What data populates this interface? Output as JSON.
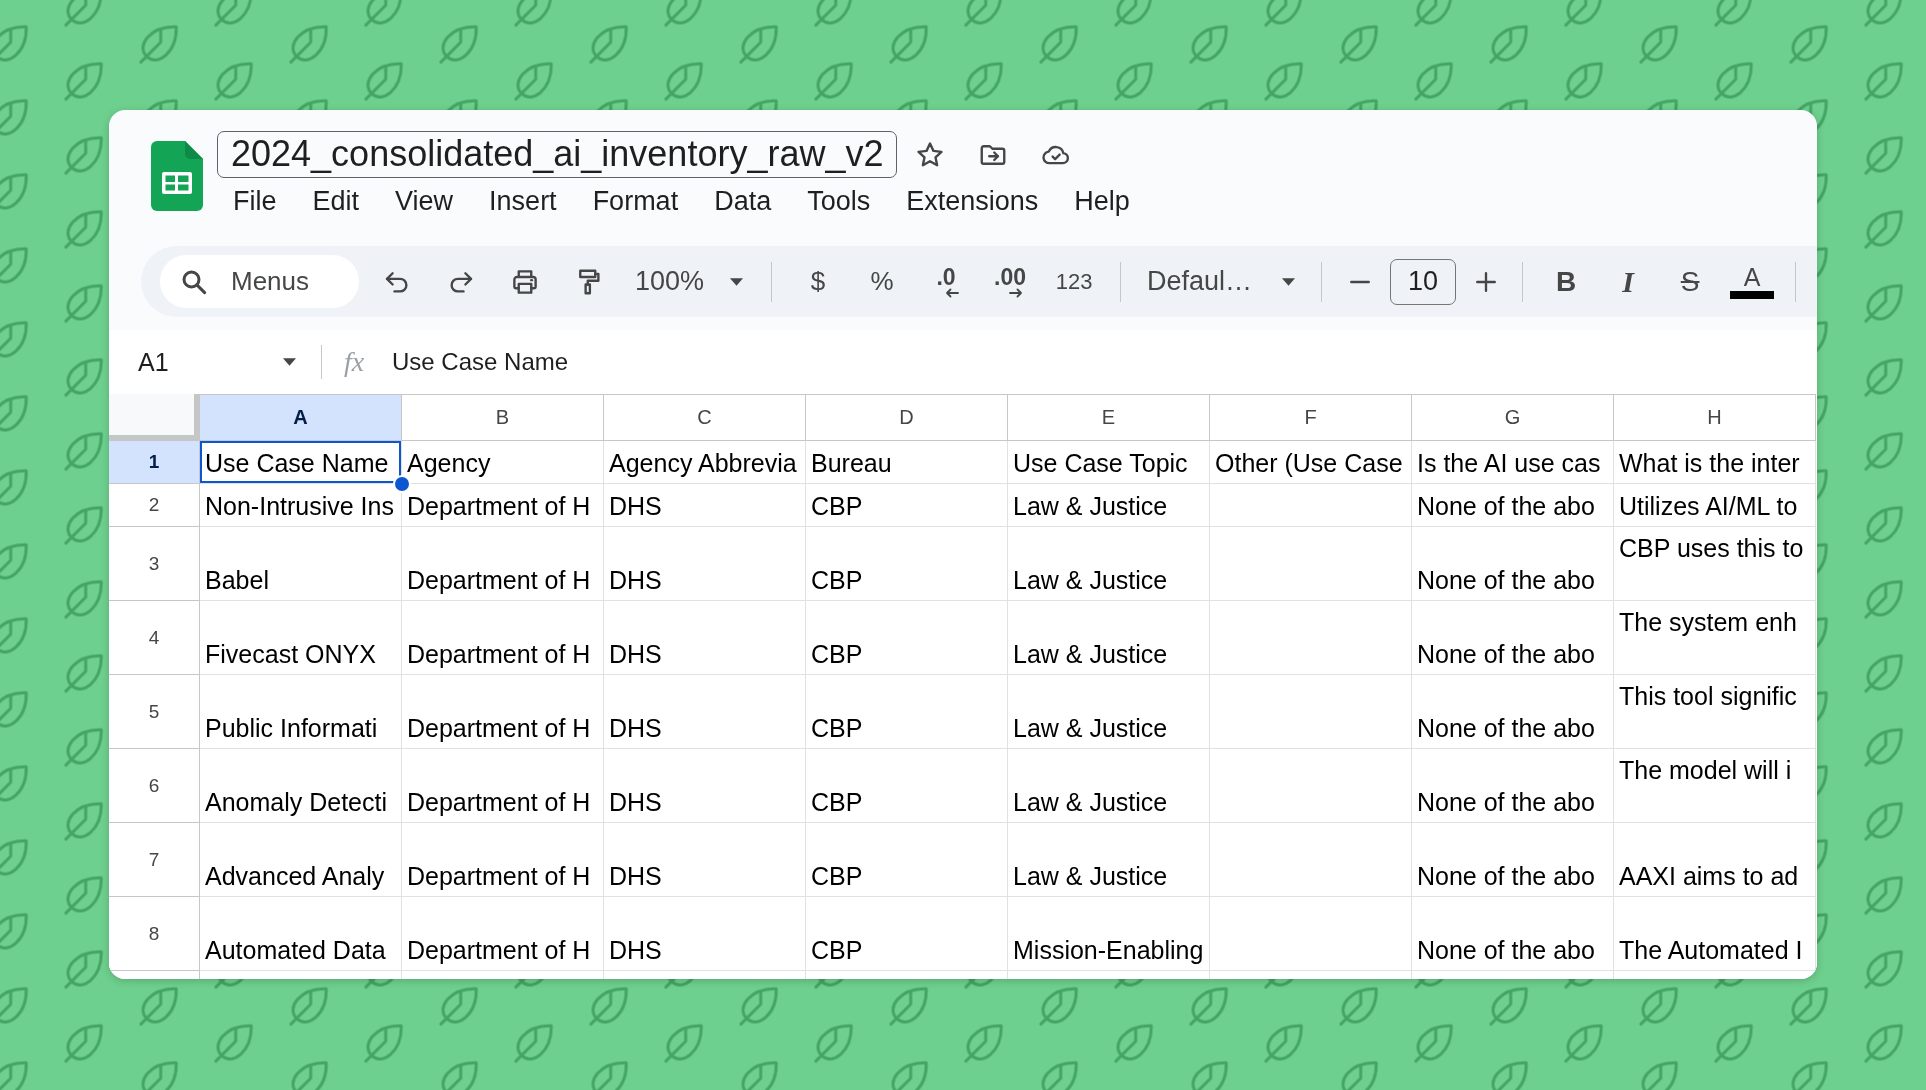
{
  "document": {
    "title": "2024_consolidated_ai_inventory_raw_v2"
  },
  "menu": [
    "File",
    "Edit",
    "View",
    "Insert",
    "Format",
    "Data",
    "Tools",
    "Extensions",
    "Help"
  ],
  "toolbar": {
    "search": {
      "placeholder": "Menus"
    },
    "zoom": "100%",
    "currency": "$",
    "percent": "%",
    "decrease_decimal": ".0",
    "increase_decimal": ".00",
    "number_format": "123",
    "font": "Defaul…",
    "font_size": "10",
    "bold": "B",
    "italic": "I",
    "strikethrough": "S",
    "text_color": {
      "label": "A",
      "color": "#000000"
    }
  },
  "formula_bar": {
    "cell_reference": "A1",
    "function_label": "fx",
    "content": "Use Case Name"
  },
  "sheet": {
    "columns": [
      {
        "label": "A",
        "selected": true
      },
      {
        "label": "B",
        "selected": false
      },
      {
        "label": "C",
        "selected": false
      },
      {
        "label": "D",
        "selected": false
      },
      {
        "label": "E",
        "selected": false
      },
      {
        "label": "F",
        "selected": false
      },
      {
        "label": "G",
        "selected": false
      },
      {
        "label": "H",
        "selected": false
      }
    ],
    "rows": [
      {
        "number": "1",
        "selected": true,
        "cells": [
          {
            "text": "Use Case Name",
            "selected": true,
            "wrapped": false
          },
          {
            "text": "Agency",
            "selected": false,
            "wrapped": false
          },
          {
            "text": "Agency Abbrevia",
            "selected": false,
            "wrapped": false
          },
          {
            "text": "Bureau",
            "selected": false,
            "wrapped": false
          },
          {
            "text": "Use Case Topic",
            "selected": false,
            "wrapped": false
          },
          {
            "text": "Other (Use Case",
            "selected": false,
            "wrapped": false
          },
          {
            "text": "Is the AI use cas",
            "selected": false,
            "wrapped": false
          },
          {
            "text": "What is the inter",
            "selected": false,
            "wrapped": false
          }
        ]
      },
      {
        "number": "2",
        "selected": false,
        "cells": [
          {
            "text": "Non-Intrusive Ins",
            "selected": false,
            "wrapped": false
          },
          {
            "text": "Department of H",
            "selected": false,
            "wrapped": false
          },
          {
            "text": "DHS",
            "selected": false,
            "wrapped": false
          },
          {
            "text": "CBP",
            "selected": false,
            "wrapped": false
          },
          {
            "text": "Law & Justice",
            "selected": false,
            "wrapped": false
          },
          {
            "selected": false
          },
          {
            "text": "None of the abo",
            "selected": false,
            "wrapped": false
          },
          {
            "text": "Utilizes AI/ML to",
            "selected": false,
            "wrapped": false
          }
        ]
      },
      {
        "number": "3",
        "selected": false,
        "cells": [
          {
            "text": "Babel",
            "selected": false,
            "wrapped": false
          },
          {
            "text": "Department of H",
            "selected": false,
            "wrapped": false
          },
          {
            "text": "DHS",
            "selected": false,
            "wrapped": false
          },
          {
            "text": "CBP",
            "selected": false,
            "wrapped": false
          },
          {
            "text": "Law & Justice",
            "selected": false,
            "wrapped": false
          },
          {
            "selected": false
          },
          {
            "text": "None of the abo",
            "selected": false,
            "wrapped": false
          },
          {
            "text": "CBP uses this to",
            "selected": false,
            "wrapped": true
          }
        ]
      },
      {
        "number": "4",
        "selected": false,
        "cells": [
          {
            "text": "Fivecast ONYX",
            "selected": false,
            "wrapped": false
          },
          {
            "text": "Department of H",
            "selected": false,
            "wrapped": false
          },
          {
            "text": "DHS",
            "selected": false,
            "wrapped": false
          },
          {
            "text": "CBP",
            "selected": false,
            "wrapped": false
          },
          {
            "text": "Law & Justice",
            "selected": false,
            "wrapped": false
          },
          {
            "selected": false
          },
          {
            "text": "None of the abo",
            "selected": false,
            "wrapped": false
          },
          {
            "text": "The system enh",
            "selected": false,
            "wrapped": true
          }
        ]
      },
      {
        "number": "5",
        "selected": false,
        "cells": [
          {
            "text": "Public Informati",
            "selected": false,
            "wrapped": false
          },
          {
            "text": "Department of H",
            "selected": false,
            "wrapped": false
          },
          {
            "text": "DHS",
            "selected": false,
            "wrapped": false
          },
          {
            "text": "CBP",
            "selected": false,
            "wrapped": false
          },
          {
            "text": "Law & Justice",
            "selected": false,
            "wrapped": false
          },
          {
            "selected": false
          },
          {
            "text": "None of the abo",
            "selected": false,
            "wrapped": false
          },
          {
            "text": "This tool signific",
            "selected": false,
            "wrapped": true
          }
        ]
      },
      {
        "number": "6",
        "selected": false,
        "cells": [
          {
            "text": "Anomaly Detecti",
            "selected": false,
            "wrapped": false
          },
          {
            "text": "Department of H",
            "selected": false,
            "wrapped": false
          },
          {
            "text": "DHS",
            "selected": false,
            "wrapped": false
          },
          {
            "text": "CBP",
            "selected": false,
            "wrapped": false
          },
          {
            "text": "Law & Justice",
            "selected": false,
            "wrapped": false
          },
          {
            "selected": false
          },
          {
            "text": "None of the abo",
            "selected": false,
            "wrapped": false
          },
          {
            "text": "The model will i",
            "selected": false,
            "wrapped": true
          }
        ]
      },
      {
        "number": "7",
        "selected": false,
        "cells": [
          {
            "text": "Advanced Analy",
            "selected": false,
            "wrapped": false
          },
          {
            "text": "Department of H",
            "selected": false,
            "wrapped": false
          },
          {
            "text": "DHS",
            "selected": false,
            "wrapped": false
          },
          {
            "text": "CBP",
            "selected": false,
            "wrapped": false
          },
          {
            "text": "Law & Justice",
            "selected": false,
            "wrapped": false
          },
          {
            "selected": false
          },
          {
            "text": "None of the abo",
            "selected": false,
            "wrapped": false
          },
          {
            "text": "AAXI aims to ad",
            "selected": false,
            "wrapped": false
          }
        ]
      },
      {
        "number": "8",
        "selected": false,
        "cells": [
          {
            "text": "Automated Data",
            "selected": false,
            "wrapped": false
          },
          {
            "text": "Department of H",
            "selected": false,
            "wrapped": false
          },
          {
            "text": "DHS",
            "selected": false,
            "wrapped": false
          },
          {
            "text": "CBP",
            "selected": false,
            "wrapped": false
          },
          {
            "text": "Mission-Enabling",
            "selected": false,
            "wrapped": false
          },
          {
            "selected": false
          },
          {
            "text": "None of the abo",
            "selected": false,
            "wrapped": false
          },
          {
            "text": "The Automated I",
            "selected": false,
            "wrapped": false
          }
        ]
      }
    ]
  }
}
